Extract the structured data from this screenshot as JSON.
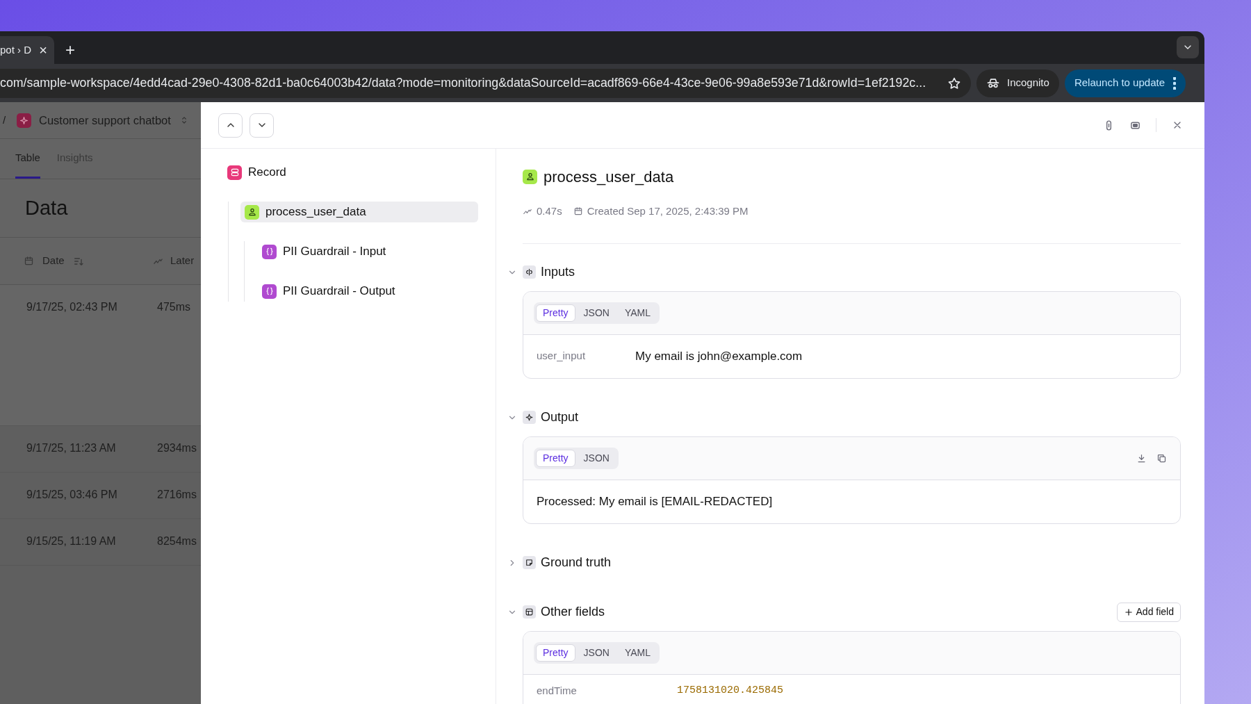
{
  "browser": {
    "tab": {
      "title": "pot › D",
      "close": "×"
    },
    "new_tab": "+",
    "address": "com/sample-workspace/4edd4cad-29e0-4308-82d1-ba0c64003b42/data?mode=monitoring&dataSourceId=acadf869-66e4-43ce-9e06-99a8e593e71d&rowId=1ef2192c...",
    "incognito": "Incognito",
    "relaunch_button": "Relaunch to update"
  },
  "project": {
    "separator": "/",
    "name": "Customer support chatbot"
  },
  "view_tabs": [
    {
      "label": "Table",
      "selected": true
    },
    {
      "label": "Insights",
      "selected": false
    }
  ],
  "page_title": "Data",
  "table": {
    "columns": [
      "Date",
      "Later"
    ],
    "rows": [
      {
        "date": "9/17/25, 02:43 PM",
        "latency": "475ms",
        "selected": true
      },
      {
        "date": "9/17/25, 11:23 AM",
        "latency": "2934ms",
        "selected": false
      },
      {
        "date": "9/15/25, 03:46 PM",
        "latency": "2716ms",
        "selected": false
      },
      {
        "date": "9/15/25, 11:19 AM",
        "latency": "8254ms",
        "selected": false
      }
    ]
  },
  "trace_tree": [
    {
      "label": "Record",
      "kind": "record",
      "children": [
        {
          "label": "process_user_data",
          "kind": "function",
          "selected": true,
          "children": [
            {
              "label": "PII Guardrail - Input",
              "kind": "guardrail",
              "selected": false
            },
            {
              "label": "PII Guardrail - Output",
              "kind": "guardrail",
              "selected": false
            }
          ]
        }
      ]
    }
  ],
  "detail": {
    "title": "process_user_data",
    "duration": "0.47s",
    "created": "Created Sep 17, 2025, 2:43:39 PM",
    "sections": [
      {
        "title": "Inputs",
        "kind": "inputs",
        "expanded": true,
        "formats": [
          {
            "label": "Pretty",
            "selected": true
          },
          {
            "label": "JSON",
            "selected": false
          },
          {
            "label": "YAML",
            "selected": false
          }
        ],
        "fields": [
          {
            "key": "user_input",
            "value": "My email is john@example.com",
            "kind": "text"
          }
        ]
      },
      {
        "title": "Output",
        "kind": "output",
        "expanded": true,
        "formats": [
          {
            "label": "Pretty",
            "selected": true
          },
          {
            "label": "JSON",
            "selected": false
          }
        ],
        "text": "Processed: My email is [EMAIL-REDACTED]"
      },
      {
        "title": "Ground truth",
        "kind": "ground_truth",
        "expanded": false
      },
      {
        "title": "Other fields",
        "kind": "other",
        "expanded": true,
        "add_button": "Add field",
        "formats": [
          {
            "label": "Pretty",
            "selected": true
          },
          {
            "label": "JSON",
            "selected": false
          },
          {
            "label": "YAML",
            "selected": false
          }
        ],
        "fields": [
          {
            "key": "endTime",
            "value": "1758131020.425845",
            "kind": "number"
          }
        ]
      }
    ]
  }
}
